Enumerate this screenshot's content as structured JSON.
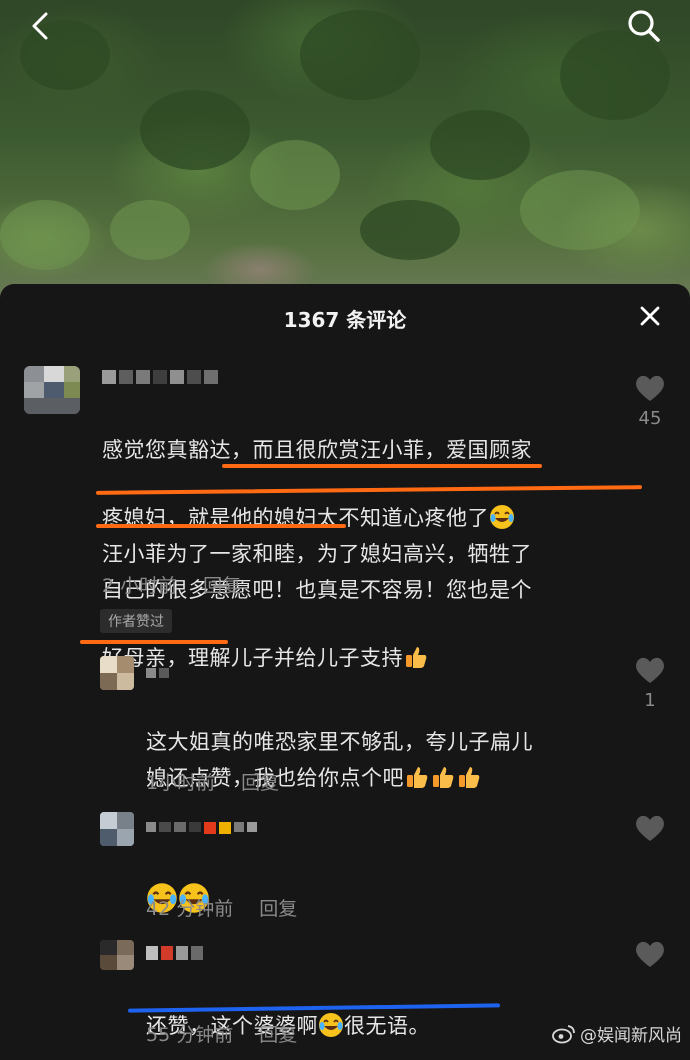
{
  "header": {
    "back_icon": "back-arrow-icon",
    "search_icon": "search-icon"
  },
  "sheet": {
    "title": "1367 条评论",
    "close_icon": "close-icon"
  },
  "comments": [
    {
      "text": "感觉您真豁达，而且很欣赏汪小菲，爱国顾家\n疼媳妇，就是他的媳妇太不知道心疼他了",
      "text2": "汪小菲为了一家和睦，为了媳妇高兴，牺牲了\n自己的很多意愿吧！也真是不容易！您也是个\n好母亲，理解儿子并给儿子支持",
      "time": "2 小时前",
      "reply": "回复",
      "badge": "作者赞过",
      "likes": "45"
    },
    {
      "text": "这大姐真的唯恐家里不够乱，夸儿子扁儿\n媳还点赞，我也给你点个吧",
      "time": "1小时前",
      "reply": "回复",
      "likes": "1"
    },
    {
      "text": "",
      "time": "42 分钟前",
      "reply": "回复",
      "likes": ""
    },
    {
      "text": "还赞，这个婆婆啊",
      "text_after": "很无语。",
      "time": "55 分钟前",
      "reply": "回复",
      "likes": ""
    }
  ],
  "watermark": "@娱闻新风尚",
  "colors": {
    "underline_orange": "#ff6a13",
    "underline_blue": "#1e62f0",
    "background": "#161616"
  }
}
